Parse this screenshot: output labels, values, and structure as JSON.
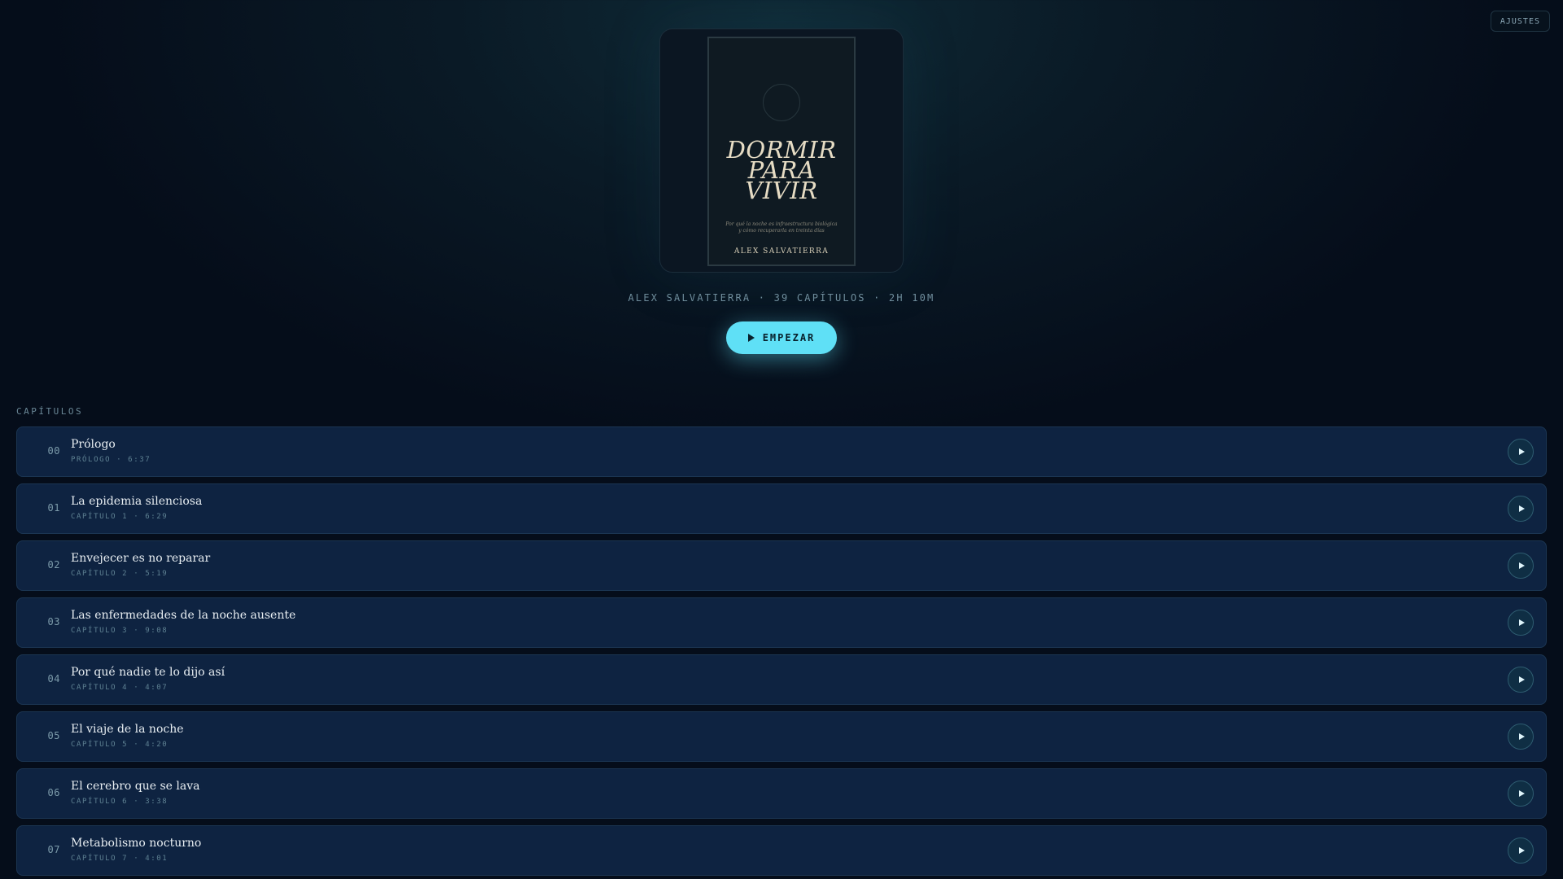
{
  "header": {
    "settings_label": "AJUSTES"
  },
  "cover": {
    "title_lines": [
      "DORMIR",
      "PARA",
      "VIVIR"
    ],
    "subtitle_lines": [
      "Por qué la noche es infraestructura biológica",
      "y cómo recuperarla en treinta días"
    ],
    "author": "ALEX SALVATIERRA"
  },
  "meta": {
    "summary": "ALEX SALVATIERRA · 39 CAPÍTULOS · 2H 10M"
  },
  "actions": {
    "start_label": "EMPEZAR"
  },
  "chapters_section": {
    "label": "CAPÍTULOS",
    "items": [
      {
        "num": "00",
        "title": "Prólogo",
        "sub": "PRÓLOGO · 6:37"
      },
      {
        "num": "01",
        "title": "La epidemia silenciosa",
        "sub": "CAPÍTULO 1 · 6:29"
      },
      {
        "num": "02",
        "title": "Envejecer es no reparar",
        "sub": "CAPÍTULO 2 · 5:19"
      },
      {
        "num": "03",
        "title": "Las enfermedades de la noche ausente",
        "sub": "CAPÍTULO 3 · 9:08"
      },
      {
        "num": "04",
        "title": "Por qué nadie te lo dijo así",
        "sub": "CAPÍTULO 4 · 4:07"
      },
      {
        "num": "05",
        "title": "El viaje de la noche",
        "sub": "CAPÍTULO 5 · 4:20"
      },
      {
        "num": "06",
        "title": "El cerebro que se lava",
        "sub": "CAPÍTULO 6 · 3:38"
      },
      {
        "num": "07",
        "title": "Metabolismo nocturno",
        "sub": "CAPÍTULO 7 · 4:01"
      }
    ]
  },
  "colors": {
    "accent": "#5fe0f6",
    "background": "#050d1a",
    "row_background": "#0e2341"
  },
  "icons": {
    "start": "play-icon",
    "chapter_play": "play-icon"
  }
}
